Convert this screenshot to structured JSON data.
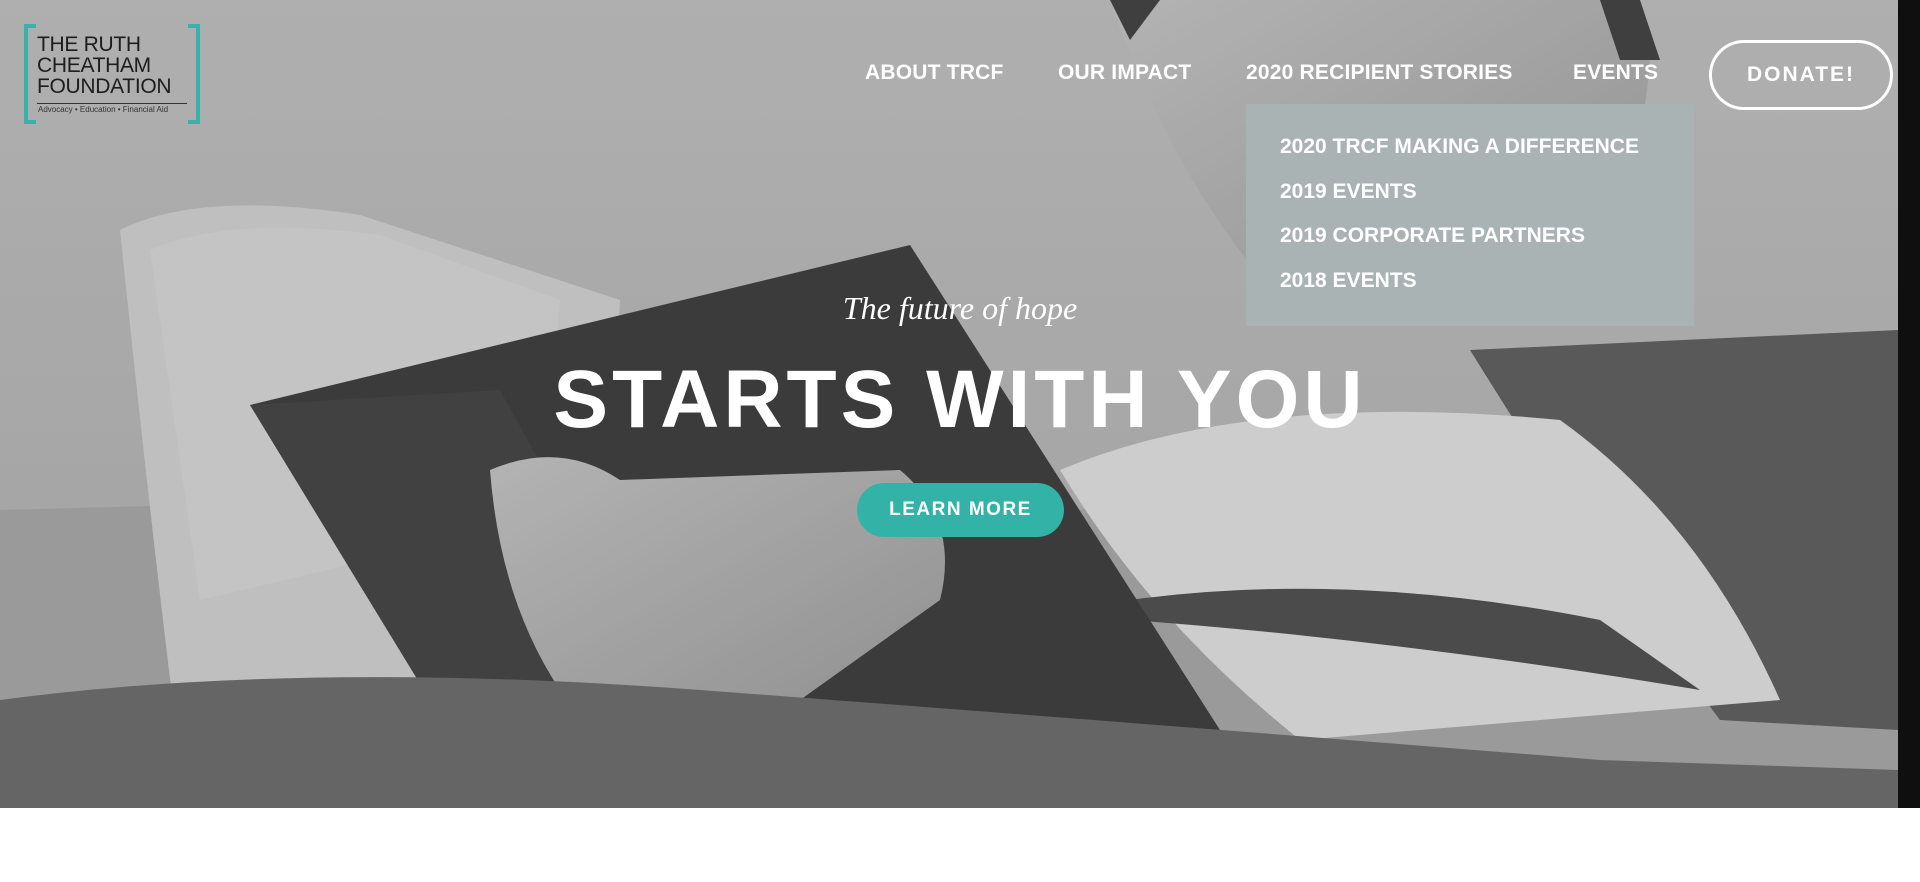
{
  "logo": {
    "line1": "THE RUTH",
    "line2": "CHEATHAM",
    "line3": "FOUNDATION",
    "tagline": "Advocacy  •  Education  •  Financial Aid",
    "bracket_color": "#3ab1a6"
  },
  "nav": {
    "items": [
      {
        "label": "ABOUT TRCF"
      },
      {
        "label": "OUR IMPACT"
      },
      {
        "label": "2020 RECIPIENT STORIES"
      },
      {
        "label": "EVENTS"
      }
    ],
    "donate_label": "DONATE!"
  },
  "dropdown": {
    "items": [
      {
        "label": "2020 TRCF MAKING A DIFFERENCE"
      },
      {
        "label": "2019 EVENTS"
      },
      {
        "label": "2019 CORPORATE PARTNERS"
      },
      {
        "label": "2018 EVENTS"
      }
    ],
    "background": "#a9b3b3"
  },
  "hero": {
    "kicker": "The future of hope",
    "headline": "STARTS WITH YOU",
    "cta_label": "LEARN MORE",
    "cta_color": "#33b3a7"
  }
}
